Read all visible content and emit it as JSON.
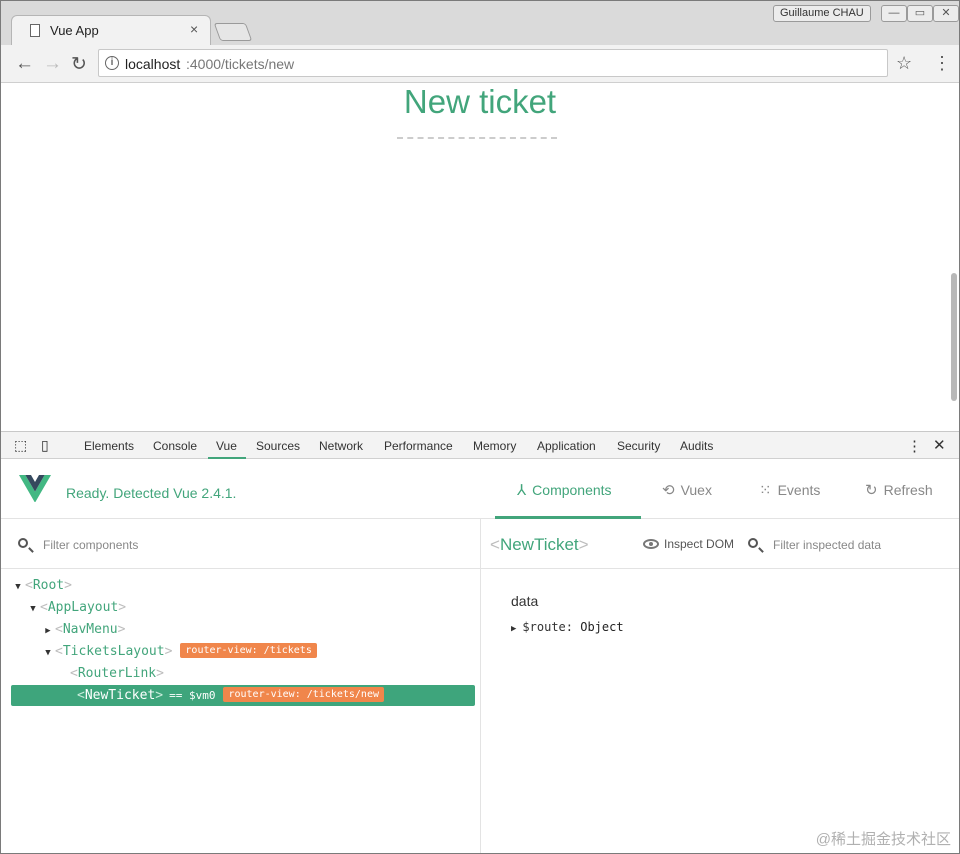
{
  "browser": {
    "tab_title": "Vue App",
    "tab_close": "×",
    "user_name": "Guillaume CHAU",
    "window_buttons": [
      "—",
      "▭",
      "✕"
    ],
    "url_host": "localhost",
    "url_path": ":4000/tickets/new"
  },
  "page": {
    "title": "New ticket"
  },
  "devtools": {
    "tabs": [
      "Elements",
      "Console",
      "Vue",
      "Sources",
      "Network",
      "Performance",
      "Memory",
      "Application",
      "Security",
      "Audits"
    ],
    "active_tab": "Vue"
  },
  "vue": {
    "status": "Ready. Detected Vue 2.4.1.",
    "tabs": [
      {
        "label": "Components",
        "icon": "components-icon",
        "active": true
      },
      {
        "label": "Vuex",
        "icon": "history-icon",
        "active": false
      },
      {
        "label": "Events",
        "icon": "events-icon",
        "active": false
      },
      {
        "label": "Refresh",
        "icon": "refresh-icon",
        "active": false
      }
    ],
    "filter_components_placeholder": "Filter components",
    "tree": [
      {
        "name": "Root",
        "arrow": "▼",
        "badge": "",
        "selected": false
      },
      {
        "name": "AppLayout",
        "arrow": "▼",
        "badge": "",
        "selected": false
      },
      {
        "name": "NavMenu",
        "arrow": "▶",
        "badge": "",
        "selected": false
      },
      {
        "name": "TicketsLayout",
        "arrow": "▼",
        "badge": "router-view: /tickets",
        "selected": false
      },
      {
        "name": "RouterLink",
        "arrow": "",
        "badge": "",
        "selected": false
      },
      {
        "name": "NewTicket",
        "arrow": "",
        "badge": "router-view: /tickets/new",
        "vm": "== $vm0",
        "selected": true
      }
    ],
    "inspected": {
      "name": "NewTicket",
      "inspect_dom": "Inspect DOM",
      "filter_data_placeholder": "Filter inspected data",
      "section": "data",
      "fields": [
        {
          "key": "$route",
          "value": "Object"
        }
      ]
    }
  },
  "watermark": "@稀土掘金技术社区",
  "colors": {
    "accent": "#42a57b",
    "badge": "#f0864b",
    "selected_row": "#3ea57c"
  }
}
